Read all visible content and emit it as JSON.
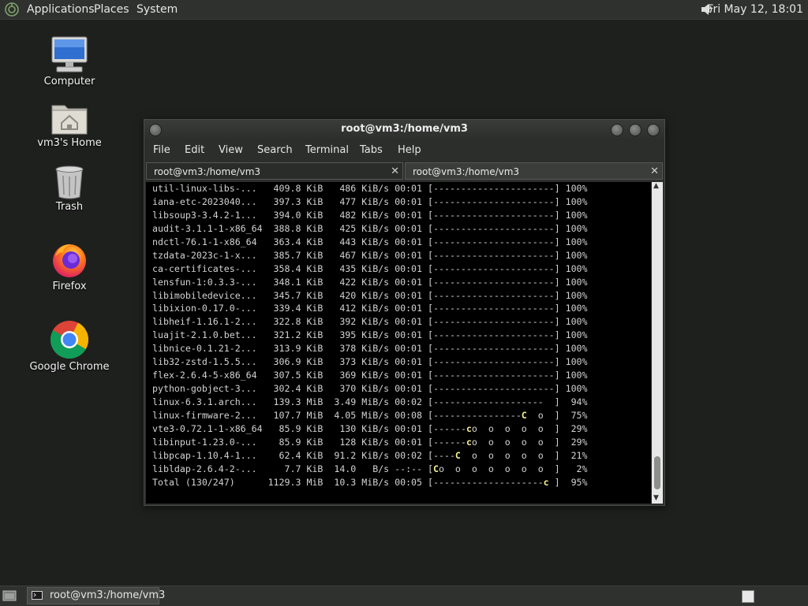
{
  "top_panel": {
    "menus": [
      "Applications",
      "Places",
      "System"
    ],
    "clock": "Fri May 12, 18:01",
    "volume_icon": "speaker-icon"
  },
  "desktop_icons": [
    {
      "label": "Computer",
      "icon": "computer-icon"
    },
    {
      "label": "vm3's Home",
      "icon": "home-folder-icon"
    },
    {
      "label": "Trash",
      "icon": "trash-icon"
    },
    {
      "label": "Firefox",
      "icon": "firefox-icon"
    },
    {
      "label": "Google Chrome",
      "icon": "chrome-icon"
    }
  ],
  "window": {
    "title": "root@vm3:/home/vm3",
    "menu": [
      "File",
      "Edit",
      "View",
      "Search",
      "Terminal",
      "Tabs",
      "Help"
    ],
    "tabs": [
      {
        "label": "root@vm3:/home/vm3",
        "active": true
      },
      {
        "label": "root@vm3:/home/vm3",
        "active": false
      }
    ],
    "terminal_lines": [
      [
        "util-linux-libs-...   409.8 KiB   486 KiB/s 00:01 [",
        "----------------------",
        "] 100%"
      ],
      [
        "iana-etc-2023040...   397.3 KiB   477 KiB/s 00:01 [",
        "----------------------",
        "] 100%"
      ],
      [
        "libsoup3-3.4.2-1...   394.0 KiB   482 KiB/s 00:01 [",
        "----------------------",
        "] 100%"
      ],
      [
        "audit-3.1.1-1-x86_64  388.8 KiB   425 KiB/s 00:01 [",
        "----------------------",
        "] 100%"
      ],
      [
        "ndctl-76.1-1-x86_64   363.4 KiB   443 KiB/s 00:01 [",
        "----------------------",
        "] 100%"
      ],
      [
        "tzdata-2023c-1-x...   385.7 KiB   467 KiB/s 00:01 [",
        "----------------------",
        "] 100%"
      ],
      [
        "ca-certificates-...   358.4 KiB   435 KiB/s 00:01 [",
        "----------------------",
        "] 100%"
      ],
      [
        "lensfun-1:0.3.3-...   348.1 KiB   422 KiB/s 00:01 [",
        "----------------------",
        "] 100%"
      ],
      [
        "libimobiledevice...   345.7 KiB   420 KiB/s 00:01 [",
        "----------------------",
        "] 100%"
      ],
      [
        "libixion-0.17.0-...   339.4 KiB   412 KiB/s 00:01 [",
        "----------------------",
        "] 100%"
      ],
      [
        "libheif-1.16.1-2...   322.8 KiB   392 KiB/s 00:01 [",
        "----------------------",
        "] 100%"
      ],
      [
        "luajit-2.1.0.bet...   321.2 KiB   395 KiB/s 00:01 [",
        "----------------------",
        "] 100%"
      ],
      [
        "libnice-0.1.21-2...   313.9 KiB   378 KiB/s 00:01 [",
        "----------------------",
        "] 100%"
      ],
      [
        "lib32-zstd-1.5.5...   306.9 KiB   373 KiB/s 00:01 [",
        "----------------------",
        "] 100%"
      ],
      [
        "flex-2.6.4-5-x86_64   307.5 KiB   369 KiB/s 00:01 [",
        "----------------------",
        "] 100%"
      ],
      [
        "python-gobject-3...   302.4 KiB   370 KiB/s 00:01 [",
        "----------------------",
        "] 100%"
      ],
      [
        "linux-6.3.1.arch...   139.3 MiB  3.49 MiB/s 00:02 [",
        "--------------------  ",
        "]  94%"
      ],
      [
        "linux-firmware-2...   107.7 MiB  4.05 MiB/s 00:08 [",
        "----------------C  o  ",
        "]  75%"
      ],
      [
        "vte3-0.72.1-1-x86_64   85.9 KiB   130 KiB/s 00:01 [",
        "------co  o  o  o  o  ",
        "]  29%"
      ],
      [
        "libinput-1.23.0-...    85.9 KiB   128 KiB/s 00:01 [",
        "------co  o  o  o  o  ",
        "]  29%"
      ],
      [
        "libpcap-1.10.4-1...    62.4 KiB  91.2 KiB/s 00:02 [",
        "----C  o  o  o  o  o  ",
        "]  21%"
      ],
      [
        "libldap-2.6.4-2-...     7.7 KiB  14.0   B/s --:-- [",
        "Co  o  o  o  o  o  o  ",
        "]   2%"
      ],
      [
        "Total (130/247)      1129.3 MiB  10.3 MiB/s 00:05 [",
        "--------------------c ",
        "]  95%"
      ]
    ]
  },
  "bottom_panel": {
    "task_label": "root@vm3:/home/vm3"
  }
}
